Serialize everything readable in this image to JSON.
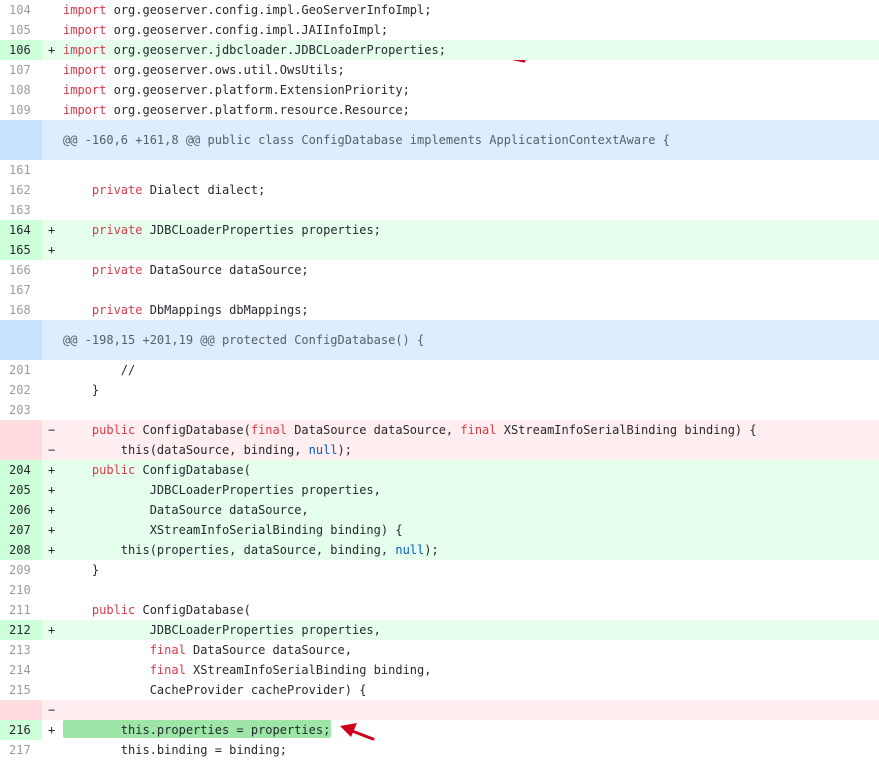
{
  "diff": {
    "rows": [
      {
        "type": "ctx",
        "num": "104",
        "marker": "",
        "tokens": [
          {
            "t": "import",
            "c": "kw"
          },
          {
            "t": " org.geoserver.config.impl.GeoServerInfoImpl;"
          }
        ]
      },
      {
        "type": "ctx",
        "num": "105",
        "marker": "",
        "tokens": [
          {
            "t": "import",
            "c": "kw"
          },
          {
            "t": " org.geoserver.config.impl.JAIInfoImpl;"
          }
        ]
      },
      {
        "type": "add",
        "num": "106",
        "marker": "+",
        "tokens": [
          {
            "t": "import",
            "c": "kw"
          },
          {
            "t": " org.geoserver.jdbcloader.JDBCLoaderProperties;"
          }
        ]
      },
      {
        "type": "ctx",
        "num": "107",
        "marker": "",
        "tokens": [
          {
            "t": "import",
            "c": "kw"
          },
          {
            "t": " org.geoserver.ows.util.OwsUtils;"
          }
        ]
      },
      {
        "type": "ctx",
        "num": "108",
        "marker": "",
        "tokens": [
          {
            "t": "import",
            "c": "kw"
          },
          {
            "t": " org.geoserver.platform.ExtensionPriority;"
          }
        ]
      },
      {
        "type": "ctx",
        "num": "109",
        "marker": "",
        "tokens": [
          {
            "t": "import",
            "c": "kw"
          },
          {
            "t": " org.geoserver.platform.resource.Resource;"
          }
        ]
      },
      {
        "type": "hunk",
        "num": "",
        "marker": "",
        "tokens": [
          {
            "t": "@@ -160,6 +161,8 @@ public class ConfigDatabase implements ApplicationContextAware {"
          }
        ]
      },
      {
        "type": "ctx",
        "num": "161",
        "marker": "",
        "tokens": []
      },
      {
        "type": "ctx",
        "num": "162",
        "marker": "",
        "tokens": [
          {
            "t": "    "
          },
          {
            "t": "private",
            "c": "kw"
          },
          {
            "t": " Dialect dialect;"
          }
        ]
      },
      {
        "type": "ctx",
        "num": "163",
        "marker": "",
        "tokens": []
      },
      {
        "type": "add",
        "num": "164",
        "marker": "+",
        "tokens": [
          {
            "t": "    "
          },
          {
            "t": "private",
            "c": "kw"
          },
          {
            "t": " JDBCLoaderProperties properties;"
          }
        ]
      },
      {
        "type": "add",
        "num": "165",
        "marker": "+",
        "tokens": []
      },
      {
        "type": "ctx",
        "num": "166",
        "marker": "",
        "tokens": [
          {
            "t": "    "
          },
          {
            "t": "private",
            "c": "kw"
          },
          {
            "t": " DataSource dataSource;"
          }
        ]
      },
      {
        "type": "ctx",
        "num": "167",
        "marker": "",
        "tokens": []
      },
      {
        "type": "ctx",
        "num": "168",
        "marker": "",
        "tokens": [
          {
            "t": "    "
          },
          {
            "t": "private",
            "c": "kw"
          },
          {
            "t": " DbMappings dbMappings;"
          }
        ]
      },
      {
        "type": "hunk",
        "num": "",
        "marker": "",
        "tokens": [
          {
            "t": "@@ -198,15 +201,19 @@ protected ConfigDatabase() {"
          }
        ]
      },
      {
        "type": "ctx",
        "num": "201",
        "marker": "",
        "tokens": [
          {
            "t": "        //"
          }
        ]
      },
      {
        "type": "ctx",
        "num": "202",
        "marker": "",
        "tokens": [
          {
            "t": "    }"
          }
        ]
      },
      {
        "type": "ctx",
        "num": "203",
        "marker": "",
        "tokens": []
      },
      {
        "type": "del",
        "num": "",
        "marker": "−",
        "tokens": [
          {
            "t": "    "
          },
          {
            "t": "public",
            "c": "kw"
          },
          {
            "t": " ConfigDatabase("
          },
          {
            "t": "final",
            "c": "kw"
          },
          {
            "t": " DataSource dataSource, "
          },
          {
            "t": "final",
            "c": "kw"
          },
          {
            "t": " XStreamInfoSerialBinding binding) {"
          }
        ]
      },
      {
        "type": "del",
        "num": "",
        "marker": "−",
        "tokens": [
          {
            "t": "        this(dataSource, binding, "
          },
          {
            "t": "null",
            "c": "lit"
          },
          {
            "t": ");"
          }
        ]
      },
      {
        "type": "add",
        "num": "204",
        "marker": "+",
        "tokens": [
          {
            "t": "    "
          },
          {
            "t": "public",
            "c": "kw"
          },
          {
            "t": " ConfigDatabase("
          }
        ]
      },
      {
        "type": "add",
        "num": "205",
        "marker": "+",
        "tokens": [
          {
            "t": "            JDBCLoaderProperties properties,"
          }
        ]
      },
      {
        "type": "add",
        "num": "206",
        "marker": "+",
        "tokens": [
          {
            "t": "            DataSource dataSource,"
          }
        ]
      },
      {
        "type": "add",
        "num": "207",
        "marker": "+",
        "tokens": [
          {
            "t": "            XStreamInfoSerialBinding binding) {"
          }
        ]
      },
      {
        "type": "add",
        "num": "208",
        "marker": "+",
        "tokens": [
          {
            "t": "        this(properties, dataSource, binding, "
          },
          {
            "t": "null",
            "c": "lit"
          },
          {
            "t": ");"
          }
        ]
      },
      {
        "type": "ctx",
        "num": "209",
        "marker": "",
        "tokens": [
          {
            "t": "    }"
          }
        ]
      },
      {
        "type": "ctx",
        "num": "210",
        "marker": "",
        "tokens": []
      },
      {
        "type": "ctx",
        "num": "211",
        "marker": "",
        "tokens": [
          {
            "t": "    "
          },
          {
            "t": "public",
            "c": "kw"
          },
          {
            "t": " ConfigDatabase("
          }
        ]
      },
      {
        "type": "add",
        "num": "212",
        "marker": "+",
        "tokens": [
          {
            "t": "            JDBCLoaderProperties properties,"
          }
        ]
      },
      {
        "type": "ctx",
        "num": "213",
        "marker": "",
        "tokens": [
          {
            "t": "            "
          },
          {
            "t": "final",
            "c": "kw"
          },
          {
            "t": " DataSource dataSource,"
          }
        ]
      },
      {
        "type": "ctx",
        "num": "214",
        "marker": "",
        "tokens": [
          {
            "t": "            "
          },
          {
            "t": "final",
            "c": "kw"
          },
          {
            "t": " XStreamInfoSerialBinding binding,"
          }
        ]
      },
      {
        "type": "ctx",
        "num": "215",
        "marker": "",
        "tokens": [
          {
            "t": "            CacheProvider cacheProvider) {"
          }
        ]
      },
      {
        "type": "del",
        "num": "",
        "marker": "−",
        "tokens": []
      },
      {
        "type": "add",
        "num": "216",
        "marker": "+",
        "tokens": [
          {
            "t": "        this.properties = properties;"
          }
        ]
      },
      {
        "type": "ctx",
        "num": "217",
        "marker": "",
        "tokens": [
          {
            "t": "        this.binding = binding;"
          }
        ]
      }
    ]
  },
  "colors": {
    "keyword": "#d73a49",
    "literal": "#005cc5",
    "added_bg": "#e6ffed",
    "deleted_bg": "#ffeef0",
    "hunk_bg": "#dbedff",
    "annotation_arrow": "#d0021b"
  },
  "annotations": [
    {
      "type": "arrow",
      "points_at_line": "106"
    },
    {
      "type": "arrow",
      "points_at_line": "212"
    },
    {
      "type": "arrow",
      "points_at_line": "216"
    }
  ]
}
